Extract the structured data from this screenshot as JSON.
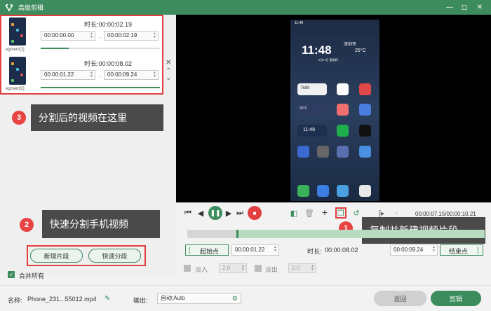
{
  "window": {
    "title": "高级剪辑"
  },
  "segments": [
    {
      "label": "egment[1]",
      "duration_label": "时长:",
      "duration": "00:00:02.19",
      "start": "00:00:00.00",
      "end": "00:00:02.19"
    },
    {
      "label": "egment[2]",
      "duration_label": "时长:",
      "duration": "00:00:08.02",
      "start": "00:00:01.22",
      "end": "00:00:09.24"
    }
  ],
  "annotations": {
    "three": {
      "num": "3",
      "text": "分割后的视频在这里"
    },
    "two": {
      "num": "2",
      "text": "快速分割手机视频"
    },
    "one": {
      "num": "1",
      "text": "复制并新建视频片段"
    }
  },
  "left_buttons": {
    "new_segment": "新增片段",
    "quick_split": "快速分段"
  },
  "merge_all": {
    "label": "合并所有",
    "checked": true
  },
  "phone_screen": {
    "status_time": "11:48",
    "clock": "11:48",
    "date": "9月27日 星期四",
    "weather_temp": "25°C",
    "weather_temp2": "25°C",
    "widget_num": "7689",
    "clock_widget": "11:48",
    "location": "深圳市"
  },
  "playback": {
    "time": "00:00:07.15/00:00:10.21"
  },
  "range": {
    "start_label": "起始点",
    "start_value": "00:00:01.22",
    "duration_label": "时长:",
    "duration_value": "00:00:08.02",
    "end_value": "00:00:09.24",
    "end_label": "结束点"
  },
  "fade": {
    "fade_in_label": "淡入",
    "fade_in_value": "2.0",
    "fade_out_label": "淡出",
    "fade_out_value": "2.0"
  },
  "footer": {
    "name_label": "名称:",
    "file_name": "Phone_231...55012.mp4",
    "output_label": "输出:",
    "output_value": "自动;Auto",
    "back_label": "返回",
    "edit_label": "剪辑"
  },
  "colors": {
    "brand": "#3c8c5e",
    "annotation": "#e24040",
    "tooltip": "#4a4a4a"
  }
}
